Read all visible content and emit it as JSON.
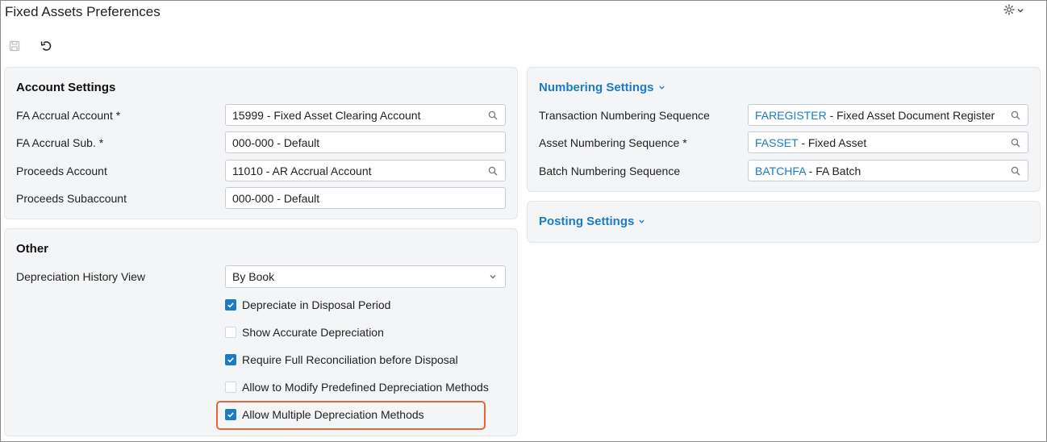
{
  "window": {
    "title": "Fixed Assets Preferences"
  },
  "icons": {
    "settings": "gear-icon",
    "settings_menu": "chevron-down-icon",
    "save": "save-icon",
    "undo": "undo-icon",
    "lookup": "search-icon",
    "dropdown": "chevron-down-icon"
  },
  "colors": {
    "accent": "#1a7bc7",
    "highlight": "#e8643c",
    "panel_bg": "#f4f5f7"
  },
  "account_settings": {
    "title": "Account Settings",
    "rows": [
      {
        "label": "FA Accrual Account",
        "required": "*",
        "value": "15999 - Fixed Asset Clearing Account",
        "lookup": true
      },
      {
        "label": "FA Accrual Sub.",
        "required": "*",
        "value": "000-000 - Default",
        "lookup": false
      },
      {
        "label": "Proceeds Account",
        "required": "",
        "value": "11010 - AR Accrual Account",
        "lookup": true
      },
      {
        "label": "Proceeds Subaccount",
        "required": "",
        "value": "000-000 - Default",
        "lookup": false
      }
    ]
  },
  "other": {
    "title": "Other",
    "history_view": {
      "label": "Depreciation History View",
      "value": "By Book"
    },
    "checkboxes": [
      {
        "label": "Depreciate in Disposal Period",
        "checked": true
      },
      {
        "label": "Show Accurate Depreciation",
        "checked": false
      },
      {
        "label": "Require Full Reconciliation before Disposal",
        "checked": true
      },
      {
        "label": "Allow to Modify Predefined Depreciation Methods",
        "checked": false
      },
      {
        "label": "Allow Multiple Depreciation Methods",
        "checked": true
      }
    ]
  },
  "numbering_settings": {
    "title": "Numbering Settings",
    "rows": [
      {
        "label": "Transaction Numbering Sequence",
        "required": "",
        "code": "FAREGISTER",
        "desc": " - Fixed Asset Document Register"
      },
      {
        "label": "Asset Numbering Sequence",
        "required": "*",
        "code": "FASSET",
        "desc": " - Fixed Asset"
      },
      {
        "label": "Batch Numbering Sequence",
        "required": "",
        "code": "BATCHFA",
        "desc": " - FA Batch"
      }
    ]
  },
  "posting_settings": {
    "title": "Posting Settings"
  }
}
